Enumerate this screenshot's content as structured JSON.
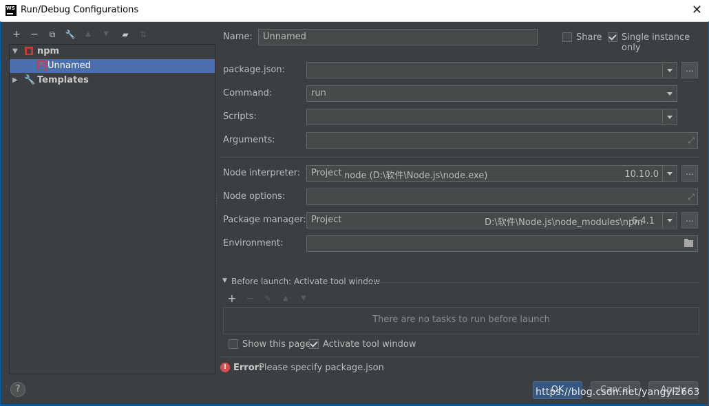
{
  "window": {
    "title": "Run/Debug Configurations",
    "app_icon_text": "WS"
  },
  "tree": {
    "npm_label": "npm",
    "unnamed_label": "Unnamed",
    "templates_label": "Templates"
  },
  "form": {
    "name_label": "Name:",
    "name_value": "Unnamed",
    "share_label": "Share",
    "single_instance_label": "Single instance only",
    "package_json_label": "package.json:",
    "package_json_value": "",
    "command_label": "Command:",
    "command_value": "run",
    "scripts_label": "Scripts:",
    "scripts_value": "",
    "arguments_label": "Arguments:",
    "arguments_value": "",
    "node_interpreter_label": "Node interpreter:",
    "node_interpreter_project": "Project",
    "node_interpreter_path": "node (D:\\软件\\Node.js\\node.exe)",
    "node_interpreter_version": "10.10.0",
    "node_options_label": "Node options:",
    "node_options_value": "",
    "package_manager_label": "Package manager:",
    "package_manager_project": "Project",
    "package_manager_path": "D:\\软件\\Node.js\\node_modules\\npm",
    "package_manager_version": "6.4.1",
    "environment_label": "Environment:",
    "environment_value": "",
    "browse_label": "..."
  },
  "before_launch": {
    "header": "Before launch: Activate tool window",
    "empty_text": "There are no tasks to run before launch",
    "show_page_label": "Show this page",
    "activate_tool_window_label": "Activate tool window"
  },
  "error": {
    "prefix": "Error:",
    "message": "Please specify package.json"
  },
  "buttons": {
    "ok": "OK",
    "cancel": "Cancel",
    "apply": "Apply",
    "help": "?"
  },
  "watermark": "https://blog.csdn.net/yangyi2663"
}
